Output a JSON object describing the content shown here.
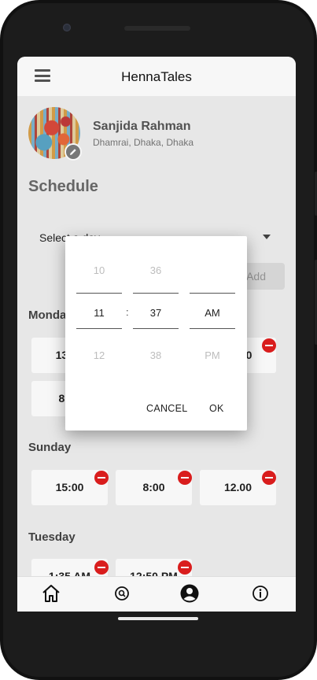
{
  "app": {
    "title": "HennaTales"
  },
  "profile": {
    "name": "Sanjida Rahman",
    "location": "Dhamrai, Dhaka, Dhaka"
  },
  "schedule": {
    "title": "Schedule",
    "select_placeholder": "Select a day",
    "add_label": "Add",
    "days": [
      {
        "label": "Monday",
        "slots": [
          "13:00",
          "",
          "10:00",
          "8:00"
        ]
      },
      {
        "label": "Sunday",
        "slots": [
          "15:00",
          "8:00",
          "12.00"
        ]
      },
      {
        "label": "Tuesday",
        "slots": [
          "1:35 AM",
          "12:50 PM"
        ]
      }
    ]
  },
  "time_picker": {
    "hours": [
      "10",
      "11",
      "12"
    ],
    "minutes": [
      "36",
      "37",
      "38"
    ],
    "ampm": [
      "",
      "AM",
      "PM"
    ],
    "separator": ":",
    "cancel_label": "CANCEL",
    "ok_label": "OK"
  },
  "nav": {
    "items": [
      "home-icon",
      "search-icon",
      "profile-icon",
      "info-icon"
    ]
  },
  "colors": {
    "remove": "#e01e1e",
    "screen_bg": "#efefef"
  }
}
